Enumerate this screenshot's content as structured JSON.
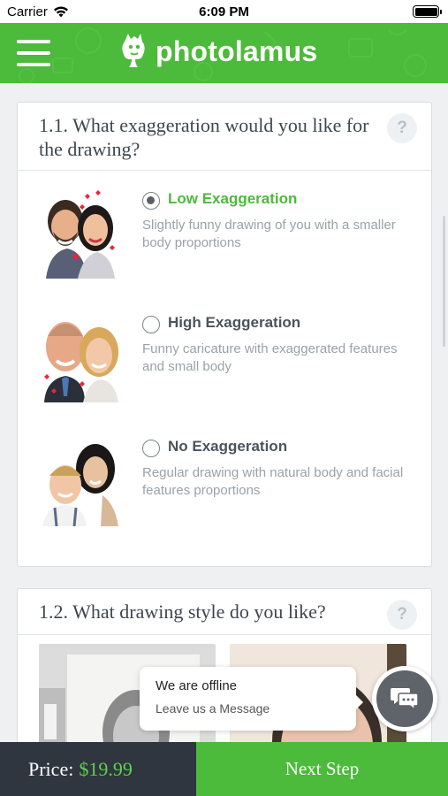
{
  "status_bar": {
    "carrier": "Carrier",
    "time": "6:09 PM"
  },
  "header": {
    "logo_text": "photolamus"
  },
  "question_1": {
    "title": "1.1. What exaggeration would you like for the drawing?",
    "help_label": "?",
    "options": [
      {
        "label": "Low Exaggeration",
        "description": "Slightly funny drawing of you with a smaller body proportions",
        "selected": true
      },
      {
        "label": "High Exaggeration",
        "description": "Funny caricature with exaggerated features and small body",
        "selected": false
      },
      {
        "label": "No Exaggeration",
        "description": "Regular drawing with natural body and facial features proportions",
        "selected": false
      }
    ]
  },
  "question_2": {
    "title": "1.2. What drawing style do you like?",
    "help_label": "?"
  },
  "chat": {
    "title": "We are offline",
    "subtitle": "Leave us a Message"
  },
  "footer": {
    "price_label": "Price:",
    "price_value": "$19.99",
    "next_label": "Next Step"
  },
  "colors": {
    "brand_green": "#4cba3a",
    "dark_footer": "#2f3640",
    "price_green": "#5fd04a"
  }
}
